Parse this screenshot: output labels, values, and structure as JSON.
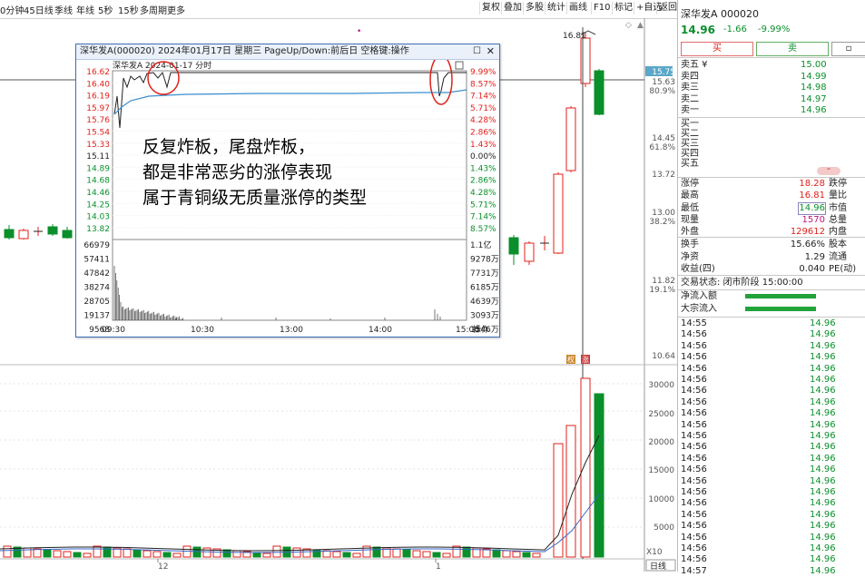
{
  "toolbar": {
    "left": [
      "0分钟",
      "45日线",
      "季线",
      "年线",
      "5秒",
      "15秒",
      "多周期",
      "更多"
    ],
    "right": [
      "复权",
      "叠加",
      "多股",
      "统计",
      "画线",
      "F10",
      "标记",
      "+自选",
      "返回"
    ]
  },
  "chart": {
    "price_labels": [
      {
        "v": "15.75",
        "hl": true
      },
      {
        "v": "15.63"
      },
      {
        "v": "80.9%"
      },
      {
        "v": "14.45"
      },
      {
        "v": "61.8%"
      },
      {
        "v": "13.72"
      },
      {
        "v": "13.00"
      },
      {
        "v": "38.2%"
      },
      {
        "v": "11.82"
      },
      {
        "v": "19.1%"
      },
      {
        "v": "10.64"
      }
    ],
    "high_label": "16.81",
    "vol_labels": [
      "30000",
      "25000",
      "20000",
      "15000",
      "10000",
      "5000"
    ],
    "vol_unit": "X10",
    "period_btn": "日线",
    "x_labels": [
      "12",
      "1"
    ],
    "marker_badges": [
      "权",
      "涨"
    ]
  },
  "popup": {
    "title": "深华发A(000020) 2024年01月17日 星期三 PageUp/Down:前后日 空格键:操作",
    "subtitle": "深华发A  2024-01-17 分时",
    "price_left": [
      "16.62",
      "16.40",
      "16.19",
      "15.97",
      "15.76",
      "15.54",
      "15.33",
      "15.11",
      "14.89",
      "14.68",
      "14.46",
      "14.25",
      "14.03",
      "13.82"
    ],
    "pct_right": [
      "9.99%",
      "8.57%",
      "7.14%",
      "5.71%",
      "4.28%",
      "2.86%",
      "1.43%",
      "0.00%",
      "1.43%",
      "2.86%",
      "4.28%",
      "5.71%",
      "7.14%",
      "8.57%"
    ],
    "vol_left": [
      "66979",
      "57411",
      "47842",
      "38274",
      "28705",
      "19137",
      "9568"
    ],
    "vol_right": [
      "1.1亿",
      "9278万",
      "7731万",
      "6185万",
      "4639万",
      "3093万",
      "1546万"
    ],
    "times": [
      "09:30",
      "10:30",
      "13:00",
      "14:00",
      "15:00"
    ],
    "op_label": "操作",
    "annotation": [
      "反复炸板，尾盘炸板，",
      "都是非常恶劣的涨停表现",
      "属于青铜级无质量涨停的类型"
    ]
  },
  "right_panel": {
    "stock": "深华发A  000020",
    "price": "14.96",
    "change": "-1.66",
    "change_pct": "-9.99%",
    "buy_btn": "买",
    "sell_btn": "卖",
    "asks": [
      {
        "label": "卖五 ¥",
        "price": "15.00"
      },
      {
        "label": "卖四",
        "price": "14.99"
      },
      {
        "label": "卖三",
        "price": "14.98"
      },
      {
        "label": "卖二",
        "price": "14.97"
      },
      {
        "label": "卖一",
        "price": "14.96"
      }
    ],
    "bids": [
      "买一",
      "买二",
      "买三",
      "买四",
      "买五"
    ],
    "stats": [
      {
        "l": "涨停",
        "v": "18.28",
        "vc": "red",
        "r": "跌停"
      },
      {
        "l": "最高",
        "v": "16.81",
        "vc": "red",
        "r": "量比"
      },
      {
        "l": "最低",
        "v": "14.96",
        "vc": "green",
        "r": "市值"
      },
      {
        "l": "现量",
        "v": "1570",
        "vc": "mag",
        "r": "总量"
      },
      {
        "l": "外盘",
        "v": "129612",
        "vc": "red",
        "r": "内盘"
      }
    ],
    "stats2": [
      {
        "l": "换手",
        "v": "15.66%",
        "r": "股本"
      },
      {
        "l": "净资",
        "v": "1.29",
        "r": "流通"
      },
      {
        "l": "收益(四)",
        "v": "0.040",
        "r": "PE(动)"
      }
    ],
    "trade_status": "交易状态: 闭市阶段 15:00:00",
    "flow1": "净流入额",
    "flow2": "大宗流入",
    "ticks": [
      {
        "t": "14:55",
        "p": "14.96"
      },
      {
        "t": "14:56",
        "p": "14.96"
      },
      {
        "t": "14:56",
        "p": "14.96"
      },
      {
        "t": "14:56",
        "p": "14.96"
      },
      {
        "t": "14:56",
        "p": "14.96"
      },
      {
        "t": "14:56",
        "p": "14.96"
      },
      {
        "t": "14:56",
        "p": "14.96"
      },
      {
        "t": "14:56",
        "p": "14.96"
      },
      {
        "t": "14:56",
        "p": "14.96"
      },
      {
        "t": "14:56",
        "p": "14.96"
      },
      {
        "t": "14:56",
        "p": "14.96"
      },
      {
        "t": "14:56",
        "p": "14.96"
      },
      {
        "t": "14:56",
        "p": "14.96"
      },
      {
        "t": "14:56",
        "p": "14.96"
      },
      {
        "t": "14:56",
        "p": "14.96"
      },
      {
        "t": "14:56",
        "p": "14.96"
      },
      {
        "t": "14:56",
        "p": "14.96"
      },
      {
        "t": "14:56",
        "p": "14.96"
      },
      {
        "t": "14:56",
        "p": "14.96"
      },
      {
        "t": "14:56",
        "p": "14.96"
      },
      {
        "t": "14:56",
        "p": "14.96"
      },
      {
        "t": "14:56",
        "p": "14.96"
      },
      {
        "t": "14:57",
        "p": "14.96"
      }
    ]
  }
}
